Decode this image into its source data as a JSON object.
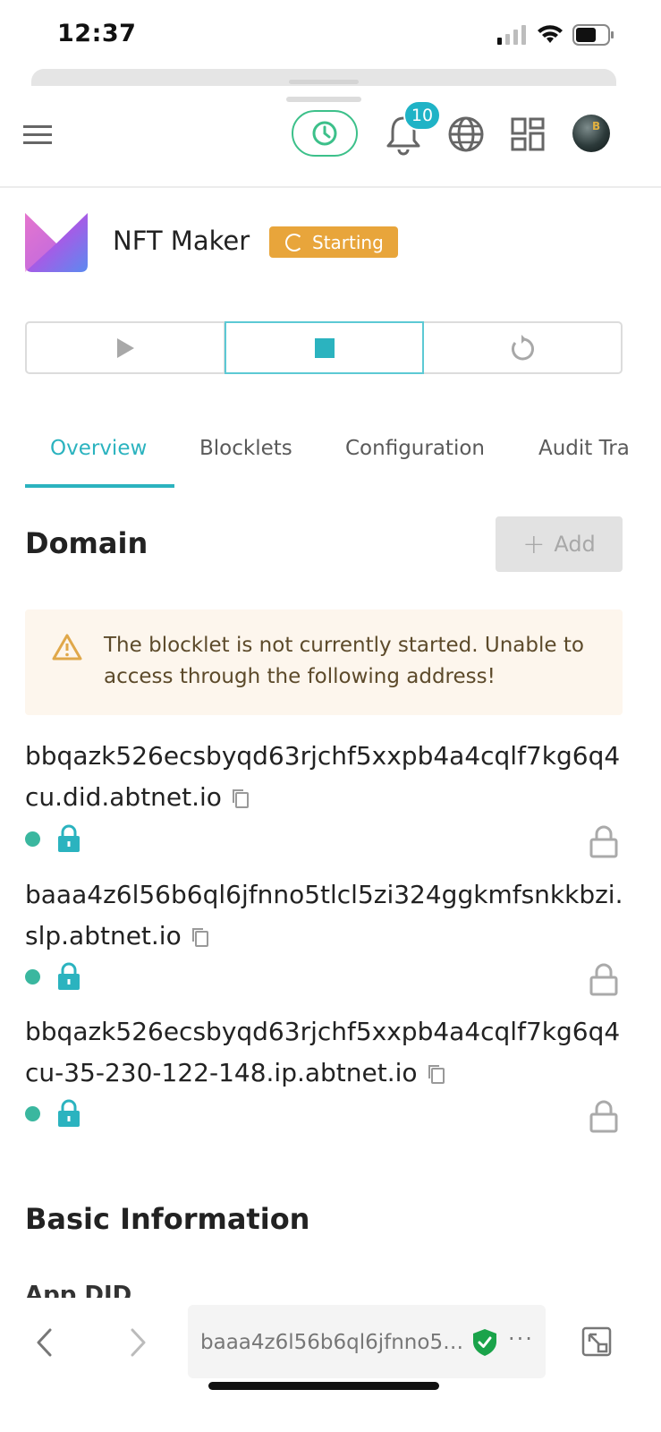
{
  "status_bar": {
    "time": "12:37"
  },
  "header": {
    "notification_count": "10",
    "icons": [
      "menu-icon",
      "clock-icon",
      "bell-icon",
      "globe-icon",
      "apps-grid-icon",
      "avatar"
    ]
  },
  "app": {
    "name": "NFT Maker",
    "status": "Starting",
    "status_color": "#e8a53b"
  },
  "actions": {
    "icons": [
      "play-icon",
      "stop-icon",
      "restart-icon"
    ],
    "accent": "#2bb3bf"
  },
  "tabs": [
    {
      "label": "Overview",
      "active": true
    },
    {
      "label": "Blocklets",
      "active": false
    },
    {
      "label": "Configuration",
      "active": false
    },
    {
      "label": "Audit Tra",
      "active": false
    }
  ],
  "domain": {
    "title": "Domain",
    "add_label": "Add",
    "warning": "The blocklet is not currently started. Unable to access through the following address!",
    "urls": [
      "bbqazk526ecsbyqd63rjchf5xxpb4a4cqlf7kg6q4cu.did.abtnet.io",
      "baaa4z6l56b6ql6jfnno5tlcl5zi324ggkmfsnkkbzi.slp.abtnet.io",
      "bbqazk526ecsbyqd63rjchf5xxpb4a4cqlf7kg6q4cu-35-230-122-148.ip.abtnet.io"
    ]
  },
  "basic_info": {
    "title": "Basic Information",
    "first_label": "App DID"
  },
  "browser": {
    "url": "baaa4z6l56b6ql6jfnno5t...",
    "more": "···"
  }
}
